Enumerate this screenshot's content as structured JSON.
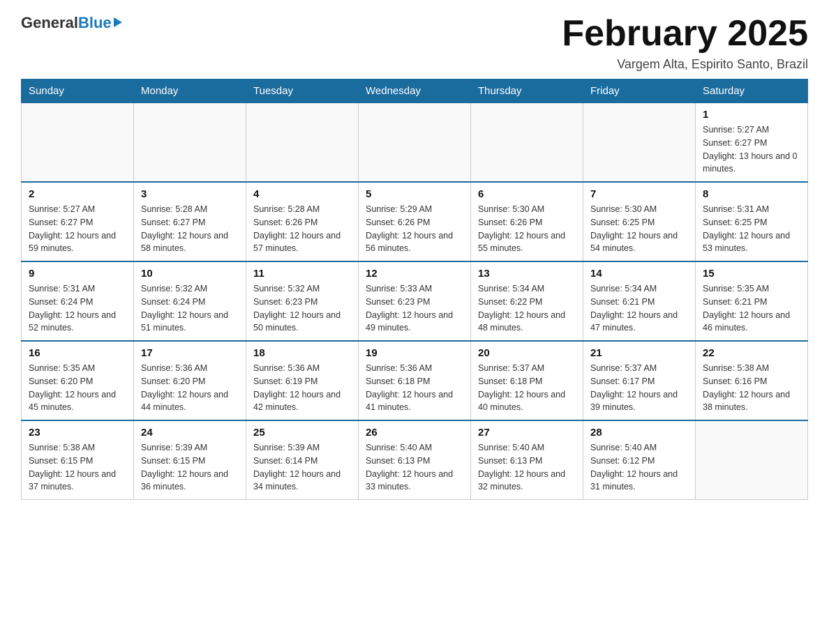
{
  "logo": {
    "general": "General",
    "blue": "Blue"
  },
  "title": "February 2025",
  "location": "Vargem Alta, Espirito Santo, Brazil",
  "days_of_week": [
    "Sunday",
    "Monday",
    "Tuesday",
    "Wednesday",
    "Thursday",
    "Friday",
    "Saturday"
  ],
  "weeks": [
    [
      {
        "day": "",
        "info": ""
      },
      {
        "day": "",
        "info": ""
      },
      {
        "day": "",
        "info": ""
      },
      {
        "day": "",
        "info": ""
      },
      {
        "day": "",
        "info": ""
      },
      {
        "day": "",
        "info": ""
      },
      {
        "day": "1",
        "info": "Sunrise: 5:27 AM\nSunset: 6:27 PM\nDaylight: 13 hours and 0 minutes."
      }
    ],
    [
      {
        "day": "2",
        "info": "Sunrise: 5:27 AM\nSunset: 6:27 PM\nDaylight: 12 hours and 59 minutes."
      },
      {
        "day": "3",
        "info": "Sunrise: 5:28 AM\nSunset: 6:27 PM\nDaylight: 12 hours and 58 minutes."
      },
      {
        "day": "4",
        "info": "Sunrise: 5:28 AM\nSunset: 6:26 PM\nDaylight: 12 hours and 57 minutes."
      },
      {
        "day": "5",
        "info": "Sunrise: 5:29 AM\nSunset: 6:26 PM\nDaylight: 12 hours and 56 minutes."
      },
      {
        "day": "6",
        "info": "Sunrise: 5:30 AM\nSunset: 6:26 PM\nDaylight: 12 hours and 55 minutes."
      },
      {
        "day": "7",
        "info": "Sunrise: 5:30 AM\nSunset: 6:25 PM\nDaylight: 12 hours and 54 minutes."
      },
      {
        "day": "8",
        "info": "Sunrise: 5:31 AM\nSunset: 6:25 PM\nDaylight: 12 hours and 53 minutes."
      }
    ],
    [
      {
        "day": "9",
        "info": "Sunrise: 5:31 AM\nSunset: 6:24 PM\nDaylight: 12 hours and 52 minutes."
      },
      {
        "day": "10",
        "info": "Sunrise: 5:32 AM\nSunset: 6:24 PM\nDaylight: 12 hours and 51 minutes."
      },
      {
        "day": "11",
        "info": "Sunrise: 5:32 AM\nSunset: 6:23 PM\nDaylight: 12 hours and 50 minutes."
      },
      {
        "day": "12",
        "info": "Sunrise: 5:33 AM\nSunset: 6:23 PM\nDaylight: 12 hours and 49 minutes."
      },
      {
        "day": "13",
        "info": "Sunrise: 5:34 AM\nSunset: 6:22 PM\nDaylight: 12 hours and 48 minutes."
      },
      {
        "day": "14",
        "info": "Sunrise: 5:34 AM\nSunset: 6:21 PM\nDaylight: 12 hours and 47 minutes."
      },
      {
        "day": "15",
        "info": "Sunrise: 5:35 AM\nSunset: 6:21 PM\nDaylight: 12 hours and 46 minutes."
      }
    ],
    [
      {
        "day": "16",
        "info": "Sunrise: 5:35 AM\nSunset: 6:20 PM\nDaylight: 12 hours and 45 minutes."
      },
      {
        "day": "17",
        "info": "Sunrise: 5:36 AM\nSunset: 6:20 PM\nDaylight: 12 hours and 44 minutes."
      },
      {
        "day": "18",
        "info": "Sunrise: 5:36 AM\nSunset: 6:19 PM\nDaylight: 12 hours and 42 minutes."
      },
      {
        "day": "19",
        "info": "Sunrise: 5:36 AM\nSunset: 6:18 PM\nDaylight: 12 hours and 41 minutes."
      },
      {
        "day": "20",
        "info": "Sunrise: 5:37 AM\nSunset: 6:18 PM\nDaylight: 12 hours and 40 minutes."
      },
      {
        "day": "21",
        "info": "Sunrise: 5:37 AM\nSunset: 6:17 PM\nDaylight: 12 hours and 39 minutes."
      },
      {
        "day": "22",
        "info": "Sunrise: 5:38 AM\nSunset: 6:16 PM\nDaylight: 12 hours and 38 minutes."
      }
    ],
    [
      {
        "day": "23",
        "info": "Sunrise: 5:38 AM\nSunset: 6:15 PM\nDaylight: 12 hours and 37 minutes."
      },
      {
        "day": "24",
        "info": "Sunrise: 5:39 AM\nSunset: 6:15 PM\nDaylight: 12 hours and 36 minutes."
      },
      {
        "day": "25",
        "info": "Sunrise: 5:39 AM\nSunset: 6:14 PM\nDaylight: 12 hours and 34 minutes."
      },
      {
        "day": "26",
        "info": "Sunrise: 5:40 AM\nSunset: 6:13 PM\nDaylight: 12 hours and 33 minutes."
      },
      {
        "day": "27",
        "info": "Sunrise: 5:40 AM\nSunset: 6:13 PM\nDaylight: 12 hours and 32 minutes."
      },
      {
        "day": "28",
        "info": "Sunrise: 5:40 AM\nSunset: 6:12 PM\nDaylight: 12 hours and 31 minutes."
      },
      {
        "day": "",
        "info": ""
      }
    ]
  ]
}
